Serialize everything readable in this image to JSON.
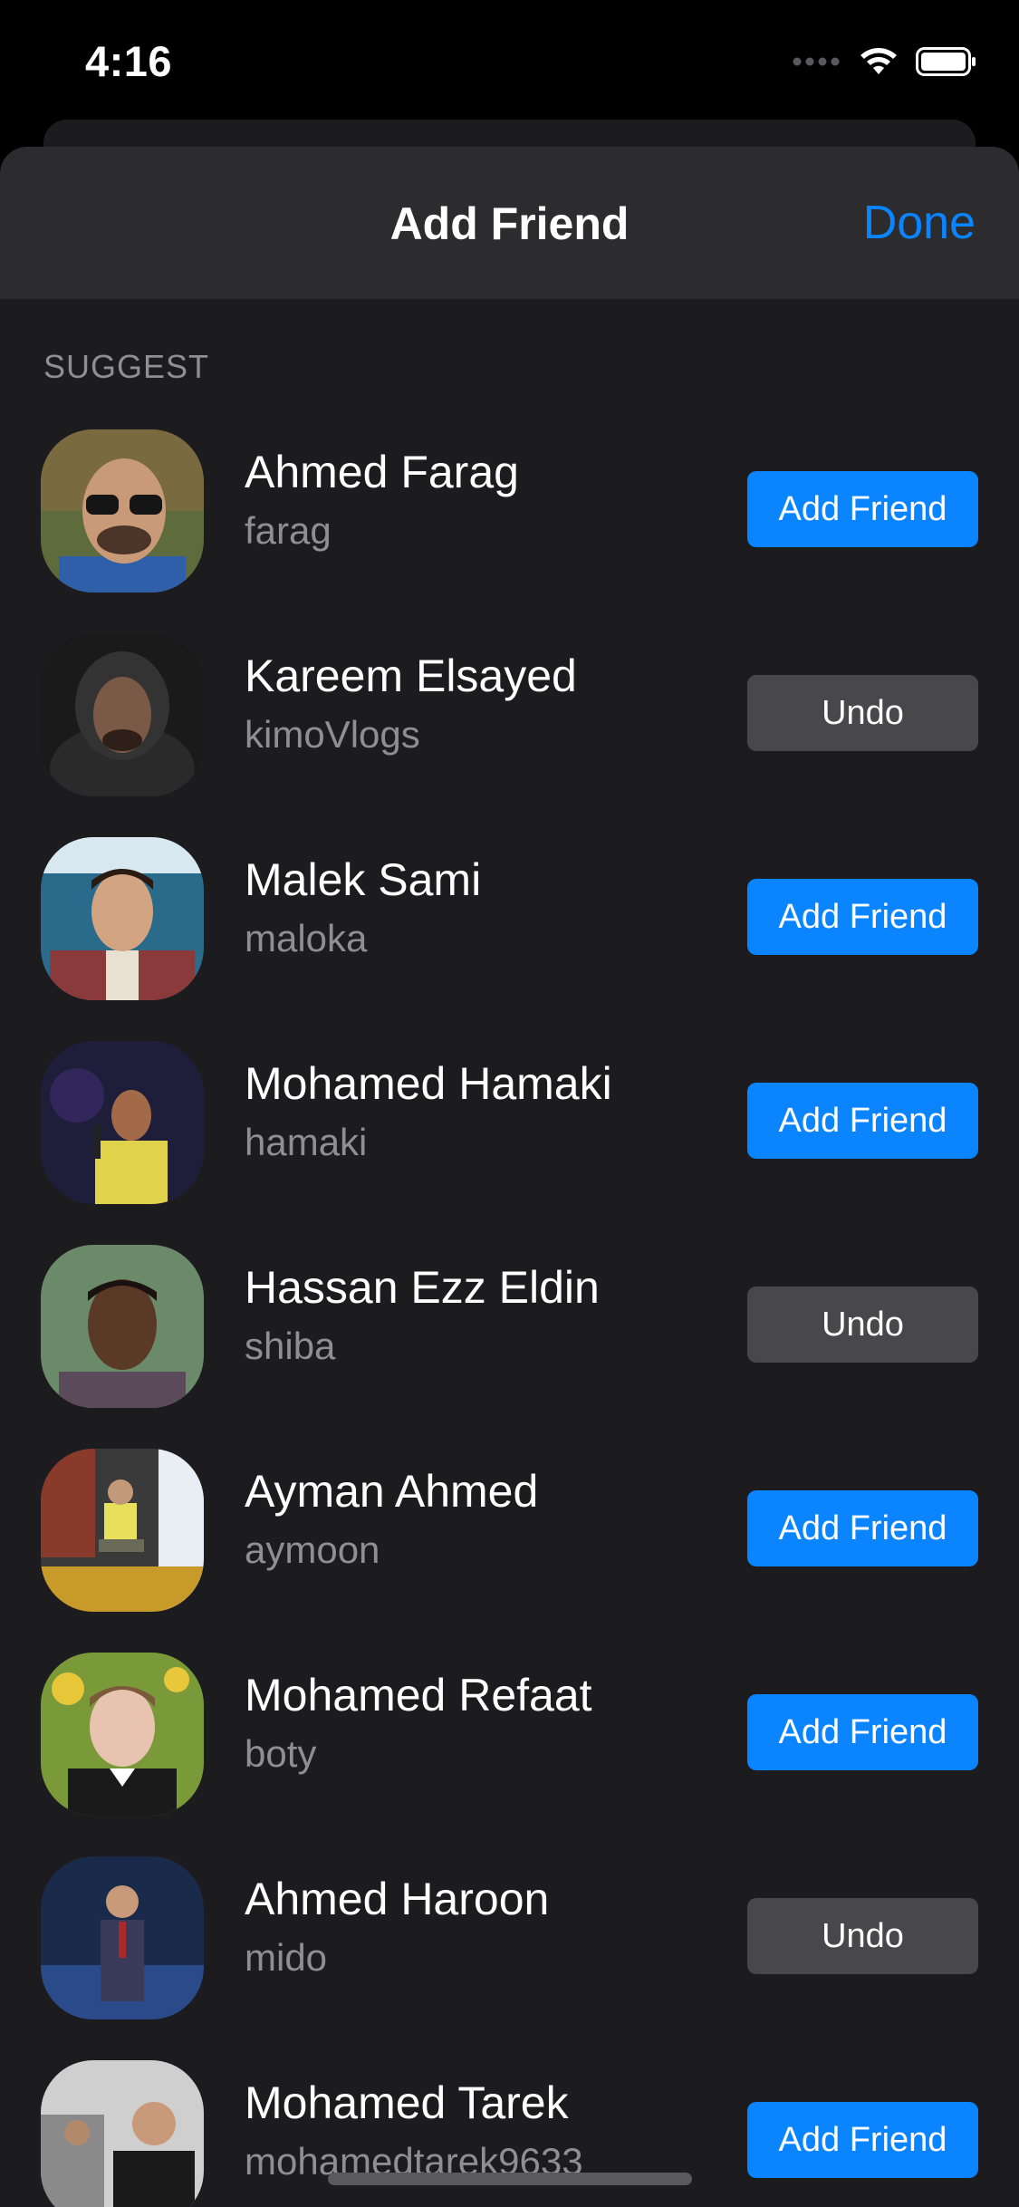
{
  "status_bar": {
    "time": "4:16",
    "icons": [
      "signal-dots-icon",
      "wifi-icon",
      "battery-icon"
    ]
  },
  "sheet": {
    "title": "Add Friend",
    "done_label": "Done"
  },
  "section_header": "SUGGEST",
  "colors": {
    "accent": "#0a84ff",
    "undo_bg": "#48484a",
    "sheet_bg": "#1c1c1e",
    "header_bg": "#2c2c2e",
    "secondary_text": "#8e8e93"
  },
  "suggestions": [
    {
      "name": "Ahmed Farag",
      "username": "farag",
      "action": "Add Friend",
      "state": "add"
    },
    {
      "name": "Kareem Elsayed",
      "username": "kimoVlogs",
      "action": "Undo",
      "state": "undo"
    },
    {
      "name": "Malek Sami",
      "username": "maloka",
      "action": "Add Friend",
      "state": "add"
    },
    {
      "name": "Mohamed Hamaki",
      "username": "hamaki",
      "action": "Add Friend",
      "state": "add"
    },
    {
      "name": "Hassan Ezz Eldin",
      "username": "shiba",
      "action": "Undo",
      "state": "undo"
    },
    {
      "name": "Ayman Ahmed",
      "username": "aymoon",
      "action": "Add Friend",
      "state": "add"
    },
    {
      "name": "Mohamed Refaat",
      "username": "boty",
      "action": "Add Friend",
      "state": "add"
    },
    {
      "name": "Ahmed Haroon",
      "username": "mido",
      "action": "Undo",
      "state": "undo"
    },
    {
      "name": "Mohamed Tarek",
      "username": "mohamedtarek9633",
      "action": "Add Friend",
      "state": "add"
    }
  ]
}
